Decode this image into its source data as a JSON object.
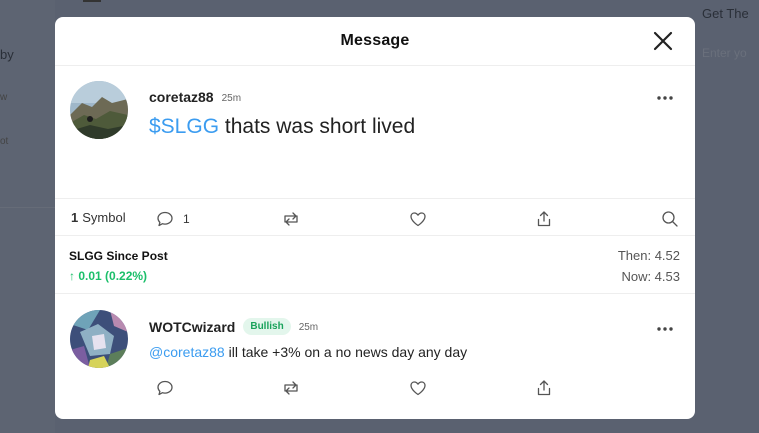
{
  "background": {
    "left_fragment_1": "by",
    "left_fragment_2": "w",
    "left_fragment_3": "ot",
    "right_fragment_1": "Get The",
    "right_fragment_2": "Enter yo"
  },
  "modal": {
    "title": "Message"
  },
  "post": {
    "username": "coretaz88",
    "time": "25m",
    "cashtag": "$SLGG",
    "text": " thats was short lived",
    "reply_count": "1"
  },
  "symbols": {
    "count": "1",
    "label": "Symbol"
  },
  "since_post": {
    "title": "SLGG Since Post",
    "change": "↑ 0.01 (0.22%)",
    "then": "Then: 4.52",
    "now": "Now: 4.53"
  },
  "reply": {
    "username": "WOTCwizard",
    "sentiment": "Bullish",
    "time": "25m",
    "mention": "@coretaz88",
    "text": " ill take +3% on a no news day any day"
  },
  "colors": {
    "accent_blue": "#3b9cf0",
    "bullish_green": "#1aa35b",
    "gain_green": "#1bbf6a",
    "overlay": "#5a6170"
  },
  "icons": [
    "close-icon",
    "more-icon",
    "comment-icon",
    "repost-icon",
    "like-icon",
    "share-icon",
    "search-icon"
  ]
}
